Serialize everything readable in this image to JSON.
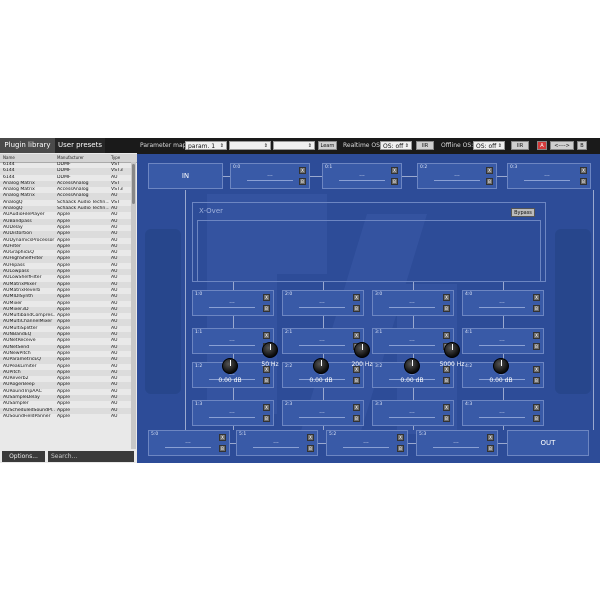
{
  "sidebar": {
    "tabs": [
      "Plugin library",
      "User presets"
    ],
    "columns": [
      "Name",
      "Manufacturer",
      "Type"
    ],
    "rows": [
      [
        "6144",
        "DDMF",
        "VST"
      ],
      [
        "6144",
        "DDMF",
        "VST3"
      ],
      [
        "6144",
        "DDMF",
        "AU"
      ],
      [
        "Analog Matrix",
        "AccessAnalog",
        "VST"
      ],
      [
        "Analog Matrix",
        "AccessAnalog",
        "VST3"
      ],
      [
        "Analog Matrix",
        "AccessAnalog",
        "AU"
      ],
      [
        "AnalogQ",
        "Schaack Audio Techn...",
        "VST"
      ],
      [
        "AnalogQ",
        "Schaack Audio Techn...",
        "AU"
      ],
      [
        "AUAudioFilePlayer",
        "Apple",
        "AU"
      ],
      [
        "AUBandpass",
        "Apple",
        "AU"
      ],
      [
        "AUDelay",
        "Apple",
        "AU"
      ],
      [
        "AUDistortion",
        "Apple",
        "AU"
      ],
      [
        "AUDynamicsProcessor",
        "Apple",
        "AU"
      ],
      [
        "AUFilter",
        "Apple",
        "AU"
      ],
      [
        "AUGraphicEQ",
        "Apple",
        "AU"
      ],
      [
        "AUHighShelfFilter",
        "Apple",
        "AU"
      ],
      [
        "AUHipass",
        "Apple",
        "AU"
      ],
      [
        "AULowpass",
        "Apple",
        "AU"
      ],
      [
        "AULowShelfFilter",
        "Apple",
        "AU"
      ],
      [
        "AUMatrixMixer",
        "Apple",
        "AU"
      ],
      [
        "AUMatrixReverb",
        "Apple",
        "AU"
      ],
      [
        "AUMIDISynth",
        "Apple",
        "AU"
      ],
      [
        "AUMixer",
        "Apple",
        "AU"
      ],
      [
        "AUMixer3D",
        "Apple",
        "AU"
      ],
      [
        "AUMultibandCompres...",
        "Apple",
        "AU"
      ],
      [
        "AUMultiChannelMixer",
        "Apple",
        "AU"
      ],
      [
        "AUMultiSplitter",
        "Apple",
        "AU"
      ],
      [
        "AUNBandEQ",
        "Apple",
        "AU"
      ],
      [
        "AUNetReceive",
        "Apple",
        "AU"
      ],
      [
        "AUNetSend",
        "Apple",
        "AU"
      ],
      [
        "AUNewPitch",
        "Apple",
        "AU"
      ],
      [
        "AUParametricEQ",
        "Apple",
        "AU"
      ],
      [
        "AUPeakLimiter",
        "Apple",
        "AU"
      ],
      [
        "AUPitch",
        "Apple",
        "AU"
      ],
      [
        "AUReverb2",
        "Apple",
        "AU"
      ],
      [
        "AURogerBeep",
        "Apple",
        "AU"
      ],
      [
        "AURoundTripAAC",
        "Apple",
        "AU"
      ],
      [
        "AUSampleDelay",
        "Apple",
        "AU"
      ],
      [
        "AUSampler",
        "Apple",
        "AU"
      ],
      [
        "AUScheduledSoundPl...",
        "Apple",
        "AU"
      ],
      [
        "AUSoundFieldPanner",
        "Apple",
        "AU"
      ]
    ],
    "options_label": "Options...",
    "search_placeholder": "Search..."
  },
  "toolbar": {
    "parameter_map_label": "Parameter map:",
    "parameter_map_value": "param. 1",
    "learn_label": "Learn",
    "realtime_os_label": "Realtime OS:",
    "realtime_os_value": "OS: off",
    "iir_label": "IIR",
    "offline_os_label": "Offline OS:",
    "offline_os_value": "OS: off",
    "a_label": "A",
    "swap_label": "<---->",
    "b_label": "B"
  },
  "matrix": {
    "in_label": "IN",
    "out_label": "OUT",
    "empty_text": "---",
    "x_glyph": "X",
    "b_glyph": "B",
    "row0": [
      "0:0",
      "0:1",
      "0:2",
      "0:3"
    ],
    "grid": [
      [
        "1:0",
        "2:0",
        "3:0",
        "4:0"
      ],
      [
        "1:1",
        "2:1",
        "3:1",
        "4:1"
      ],
      [
        "1:2",
        "2:2",
        "3:2",
        "4:2"
      ],
      [
        "1:3",
        "2:3",
        "3:3",
        "4:3"
      ]
    ],
    "row5": [
      "5:0",
      "5:1",
      "5:2",
      "5:3"
    ]
  },
  "xover": {
    "title": "X-Over",
    "bypass_label": "Bypass",
    "gains": [
      "0.00 dB",
      "0.00 dB",
      "0.00 dB",
      "0.00 dB"
    ],
    "frequencies": [
      "50 Hz",
      "200 Hz",
      "5000 Hz"
    ]
  },
  "watermark": "DDMF",
  "colors": {
    "background": "#2d4c98",
    "slot": "#395aa7",
    "accent_red": "#d33a3a"
  }
}
